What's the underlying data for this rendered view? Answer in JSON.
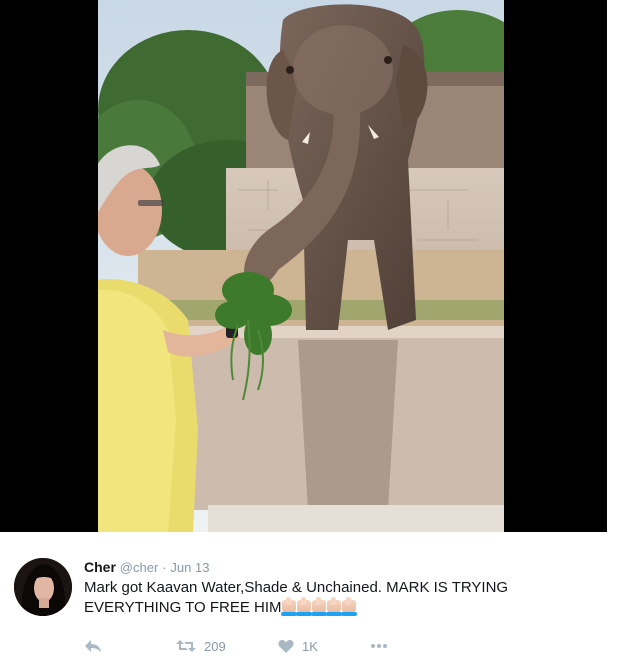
{
  "tweet": {
    "display_name": "Cher",
    "handle": "@cher",
    "separator": "·",
    "timestamp": "Jun 13",
    "text_line_1": "Mark got Kaavan Water,Shade & Unchained. MARK IS TRYING",
    "text_line_2": "EVERYTHING TO FREE HIM"
  },
  "actions": {
    "reply_icon": "reply-icon",
    "retweet_icon": "retweet-icon",
    "retweet_count": "209",
    "like_icon": "heart-icon",
    "like_count": "1K",
    "more_icon": "more-dots-icon"
  },
  "media": {
    "description_icon": "photo",
    "emoji_count": 5
  },
  "colors": {
    "name": "#14171a",
    "meta": "#8899a6",
    "action": "#aab8c2"
  }
}
